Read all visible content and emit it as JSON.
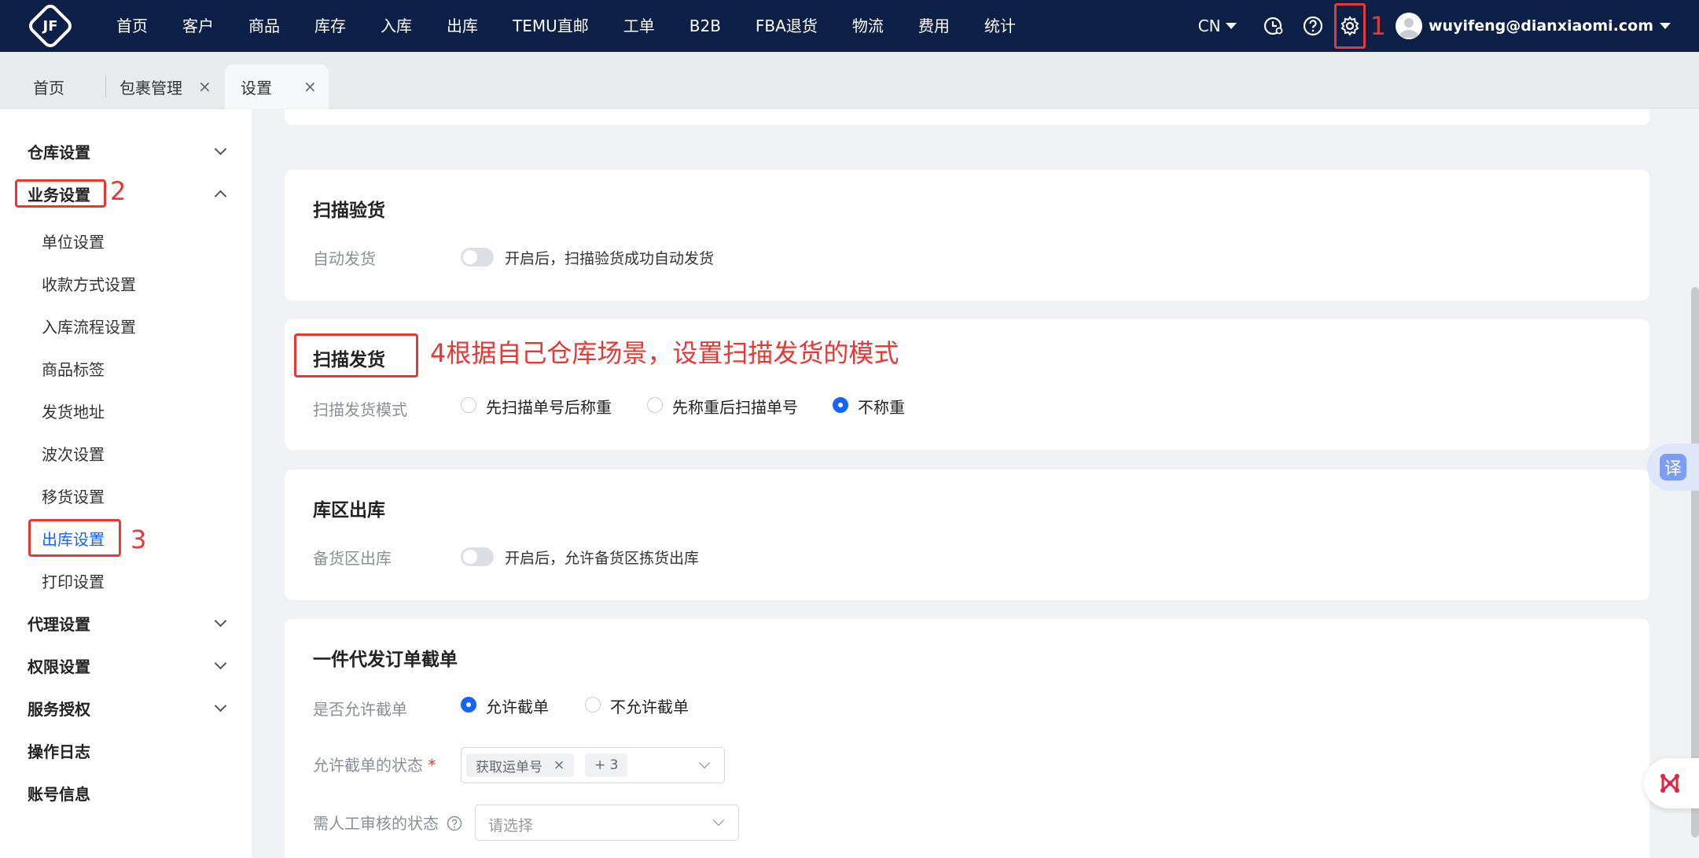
{
  "logo_text": "JF",
  "nav": [
    "首页",
    "客户",
    "商品",
    "库存",
    "入库",
    "出库",
    "TEMU直邮",
    "工单",
    "B2B",
    "FBA退货",
    "物流",
    "费用",
    "统计"
  ],
  "lang": "CN",
  "user_email": "wuyifeng@dianxiaomi.com",
  "tabs": [
    {
      "label": "首页"
    },
    {
      "label": "包裹管理",
      "close": "×"
    },
    {
      "label": "设置",
      "close": "×"
    }
  ],
  "sidebar": {
    "warehouse": "仓库设置",
    "business": "业务设置",
    "sub": [
      "单位设置",
      "收款方式设置",
      "入库流程设置",
      "商品标签",
      "发货地址",
      "波次设置",
      "移货设置",
      "出库设置",
      "打印设置"
    ],
    "agent": "代理设置",
    "permission": "权限设置",
    "service": "服务授权",
    "oplog": "操作日志",
    "account": "账号信息"
  },
  "annotations": {
    "n1": "1",
    "n2": "2",
    "n3": "3",
    "n4": "4根据自己仓库场景，设置扫描发货的模式"
  },
  "scan_check": {
    "title": "扫描验货",
    "label": "自动发货",
    "desc": "开启后，扫描验货成功自动发货"
  },
  "scan_ship": {
    "title": "扫描发货",
    "label": "扫描发货模式",
    "options": [
      "先扫描单号后称重",
      "先称重后扫描单号",
      "不称重"
    ],
    "selected": "不称重"
  },
  "zone_out": {
    "title": "库区出库",
    "label": "备货区出库",
    "desc": "开启后，允许备货区拣货出库"
  },
  "intercept": {
    "title": "一件代发订单截单",
    "allow_label": "是否允许截单",
    "allow_options": [
      "允许截单",
      "不允许截单"
    ],
    "allow_selected": "允许截单",
    "status_label": "允许截单的状态",
    "required_mark": "*",
    "status_tag": "获取运单号",
    "status_more": "+ 3",
    "manual_label": "需人工审核的状态",
    "manual_placeholder": "请选择"
  },
  "float": {
    "translate": "译"
  },
  "colors": {
    "topbar": "#0b1f47",
    "primary": "#1664ff",
    "annotation": "#e53935"
  }
}
